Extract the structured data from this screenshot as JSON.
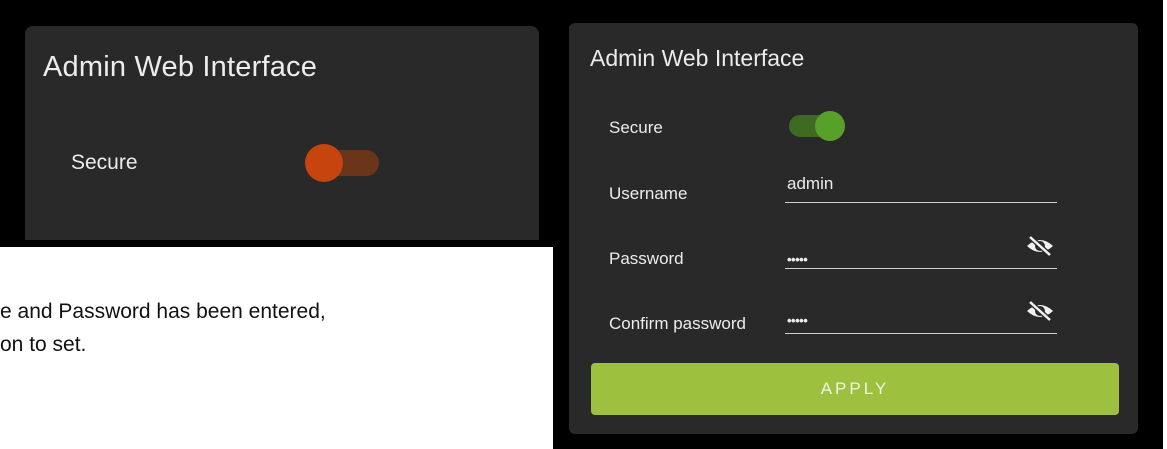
{
  "left_panel": {
    "title": "Admin Web Interface",
    "secure_label": "Secure",
    "secure_toggle": {
      "state": "off",
      "color": "#c8440e"
    }
  },
  "instructions": {
    "line1": "e and Password has been entered,",
    "line2": "on to set."
  },
  "right_panel": {
    "title": "Admin Web Interface",
    "secure_label": "Secure",
    "secure_toggle": {
      "state": "on",
      "color": "#57a02a"
    },
    "username_label": "Username",
    "username_value": "admin",
    "password_label": "Password",
    "password_value": "•••••",
    "confirm_label": "Confirm password",
    "confirm_value": "•••••",
    "password_icon": "eye-off-icon",
    "confirm_icon": "eye-off-icon",
    "apply_label": "APPLY",
    "apply_color": "#9dc03e"
  }
}
